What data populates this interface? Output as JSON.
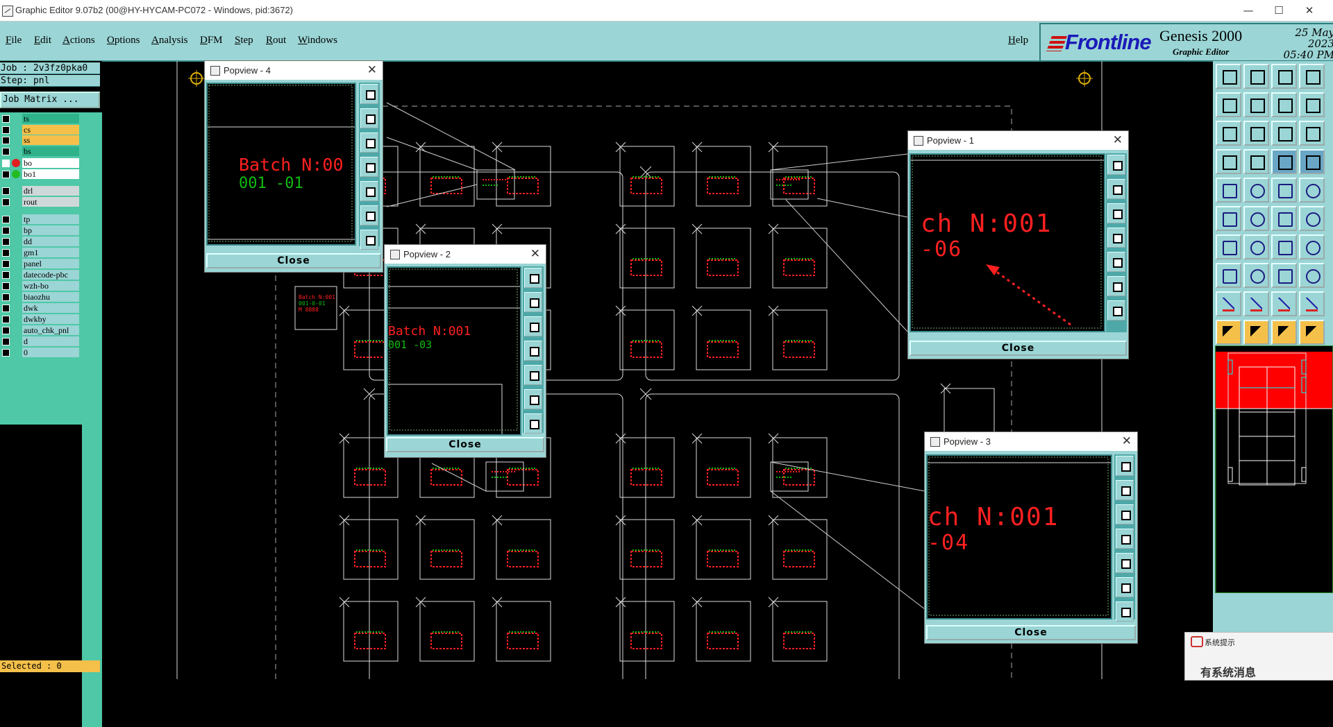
{
  "window": {
    "title": "Graphic Editor 9.07b2 (00@HY-HYCAM-PC072 - Windows, pid:3672)",
    "minimize": "—",
    "maximize": "☐",
    "close": "✕"
  },
  "menu": {
    "items": [
      "File",
      "Edit",
      "Actions",
      "Options",
      "Analysis",
      "DFM",
      "Step",
      "Rout",
      "Windows"
    ],
    "help": "Help"
  },
  "brand": {
    "logo": "Frontline",
    "product": "Genesis 2000",
    "subtitle": "Graphic Editor",
    "date": "25 May 2023",
    "time": "05:40 PM"
  },
  "job": {
    "job_label": "Job : 2v3fz0pka0",
    "step_label": "Step: pnl",
    "matrix_button": "Job Matrix ...",
    "selected": "Selected : 0"
  },
  "layers": [
    {
      "name": "ts",
      "bg": "#2fb28a"
    },
    {
      "name": "cs",
      "bg": "#f5c04a"
    },
    {
      "name": "ss",
      "bg": "#f5c04a"
    },
    {
      "name": "bs",
      "bg": "#2fb28a"
    },
    {
      "name": "bo",
      "bg": "#ffffff",
      "dot": "#e02020",
      "checked": true
    },
    {
      "name": "bo1",
      "bg": "#ffffff",
      "dot": "#22bb22"
    },
    {
      "name": "drl",
      "bg": "#cfd8d8"
    },
    {
      "name": "rout",
      "bg": "#cfd8d8"
    },
    {
      "name": "tp",
      "bg": "#9bd5d5"
    },
    {
      "name": "bp",
      "bg": "#9bd5d5"
    },
    {
      "name": "dd",
      "bg": "#9bd5d5"
    },
    {
      "name": "gm1",
      "bg": "#9bd5d5"
    },
    {
      "name": "panel",
      "bg": "#9bd5d5"
    },
    {
      "name": "datecode-pbc",
      "bg": "#9bd5d5"
    },
    {
      "name": "wzh-bo",
      "bg": "#9bd5d5"
    },
    {
      "name": "biaozhu",
      "bg": "#9bd5d5"
    },
    {
      "name": "dwk",
      "bg": "#9bd5d5"
    },
    {
      "name": "dwkby",
      "bg": "#9bd5d5"
    },
    {
      "name": "auto_chk_pnl",
      "bg": "#9bd5d5"
    },
    {
      "name": "d",
      "bg": "#9bd5d5"
    },
    {
      "name": "0",
      "bg": "#9bd5d5"
    }
  ],
  "popviews": [
    {
      "title": "Popview - 4",
      "close": "Close",
      "line1": "Batch N:00",
      "line2": "001 -01"
    },
    {
      "title": "Popview - 2",
      "close": "Close",
      "line1": "Batch N:001",
      "line2": "001 -03"
    },
    {
      "title": "Popview - 1",
      "close": "Close",
      "line1": "ch N:001",
      "line2": "-06"
    },
    {
      "title": "Popview - 3",
      "close": "Close",
      "line1": "ch N:001",
      "line2": "-04"
    }
  ],
  "board_label": {
    "line1": "Batch N:001",
    "line2": "001-0-01",
    "line3": "M 8888"
  },
  "notification": {
    "title": "系统提示",
    "body": "有系统消息"
  },
  "colors": {
    "ui_teal": "#9bd5d5",
    "layer_green": "#4ec8a6",
    "highlight_yellow": "#f5c04a",
    "feature_red": "#ff2020",
    "feature_green": "#11bb11"
  }
}
